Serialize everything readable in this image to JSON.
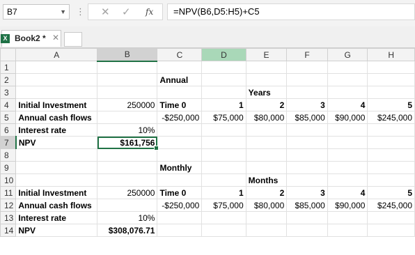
{
  "formula_bar": {
    "name_box": "B7",
    "name_box_arrow": "▼",
    "dots": "⋮",
    "cancel": "✕",
    "enter": "✓",
    "fx": "fx",
    "formula": "=NPV(B6,D5:H5)+C5"
  },
  "workbook_tab": {
    "icon": "X",
    "label": "Book2 *",
    "close": "✕"
  },
  "columns": [
    "",
    "A",
    "B",
    "C",
    "D",
    "E",
    "F",
    "G",
    "H"
  ],
  "rows": [
    {
      "n": "1",
      "A": "",
      "B": "",
      "C": "",
      "D": "",
      "E": "",
      "F": "",
      "G": "",
      "H": ""
    },
    {
      "n": "2",
      "A": "",
      "B": "",
      "C": "Annual",
      "D": "",
      "E": "",
      "F": "",
      "G": "",
      "H": ""
    },
    {
      "n": "3",
      "A": "",
      "B": "",
      "C": "",
      "D": "",
      "E": "Years",
      "F": "",
      "G": "",
      "H": ""
    },
    {
      "n": "4",
      "A": "Initial Investment",
      "B": "250000",
      "C": "Time 0",
      "D": "1",
      "E": "2",
      "F": "3",
      "G": "4",
      "H": "5"
    },
    {
      "n": "5",
      "A": "Annual cash flows",
      "B": "",
      "C": "-$250,000",
      "D": "$75,000",
      "E": "$80,000",
      "F": "$85,000",
      "G": "$90,000",
      "H": "$245,000"
    },
    {
      "n": "6",
      "A": "Interest rate",
      "B": "10%",
      "C": "",
      "D": "",
      "E": "",
      "F": "",
      "G": "",
      "H": ""
    },
    {
      "n": "7",
      "A": "NPV",
      "B": "$161,756",
      "C": "",
      "D": "",
      "E": "",
      "F": "",
      "G": "",
      "H": ""
    },
    {
      "n": "8",
      "A": "",
      "B": "",
      "C": "",
      "D": "",
      "E": "",
      "F": "",
      "G": "",
      "H": ""
    },
    {
      "n": "9",
      "A": "",
      "B": "",
      "C": "Monthly",
      "D": "",
      "E": "",
      "F": "",
      "G": "",
      "H": ""
    },
    {
      "n": "10",
      "A": "",
      "B": "",
      "C": "",
      "D": "",
      "E": "Months",
      "F": "",
      "G": "",
      "H": ""
    },
    {
      "n": "11",
      "A": "Initial Investment",
      "B": "250000",
      "C": "Time 0",
      "D": "1",
      "E": "2",
      "F": "3",
      "G": "4",
      "H": "5"
    },
    {
      "n": "12",
      "A": "Annual cash flows",
      "B": "",
      "C": "-$250,000",
      "D": "$75,000",
      "E": "$80,000",
      "F": "$85,000",
      "G": "$90,000",
      "H": "$245,000"
    },
    {
      "n": "13",
      "A": "Interest rate",
      "B": "10%",
      "C": "",
      "D": "",
      "E": "",
      "F": "",
      "G": "",
      "H": ""
    },
    {
      "n": "14",
      "A": "NPV",
      "B": "$308,076.71",
      "C": "",
      "D": "",
      "E": "",
      "F": "",
      "G": "",
      "H": ""
    }
  ],
  "colors": {
    "accent": "#217346",
    "header_selected": "#d2d2d2",
    "header_highlight": "#a9d8b8"
  }
}
